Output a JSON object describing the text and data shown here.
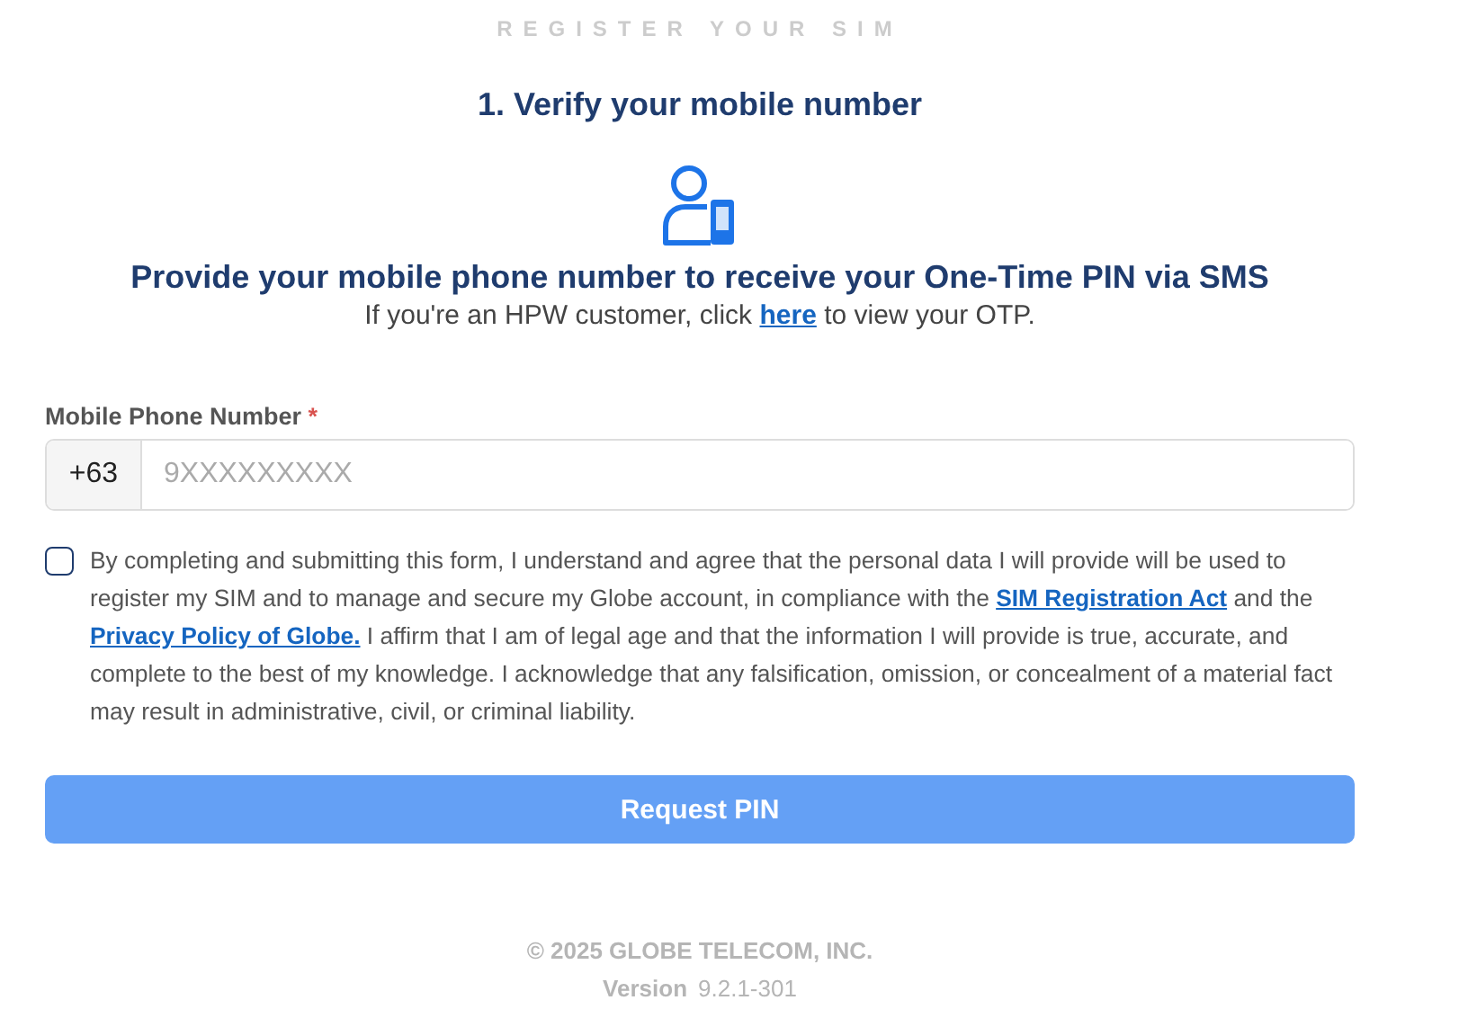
{
  "page_title": "REGISTER YOUR SIM",
  "step_heading": "**1.** Verify your mobile number",
  "prompt": "Provide your mobile phone number to receive your One-Time PIN via SMS",
  "hint": [
    {
      "kind": "text",
      "text": "If you're an HPW customer, click "
    },
    {
      "kind": "link",
      "text": "here"
    },
    {
      "kind": "text",
      "text": " to view your OTP."
    }
  ],
  "phone_field": {
    "label": "Mobile Phone Number",
    "required_mark": "*",
    "prefix": "+63",
    "placeholder": "9XXXXXXXXX"
  },
  "consent": {
    "checked": false,
    "parts": [
      {
        "kind": "text",
        "text": "By completing and submitting this form, I understand and agree that the personal data I will provide will be used to register my SIM and to manage and secure my Globe account, in compliance with the "
      },
      {
        "kind": "link",
        "text": "SIM Registration Act"
      },
      {
        "kind": "text",
        "text": " and the "
      },
      {
        "kind": "link",
        "text": "Privacy Policy of Globe."
      },
      {
        "kind": "text",
        "text": " I affirm that I am of legal age and that the information I will provide is true, accurate, and complete to the best of my knowledge. I acknowledge that any falsification, omission, or concealment of a material fact may result in administrative, civil, or criminal liability."
      }
    ]
  },
  "submit_button": {
    "label": "Request PIN",
    "disabled": true
  },
  "footer": {
    "copyright": "© 2025 GLOBE TELECOM, INC.",
    "version_label": "Version",
    "version": "9.2.1-301"
  }
}
